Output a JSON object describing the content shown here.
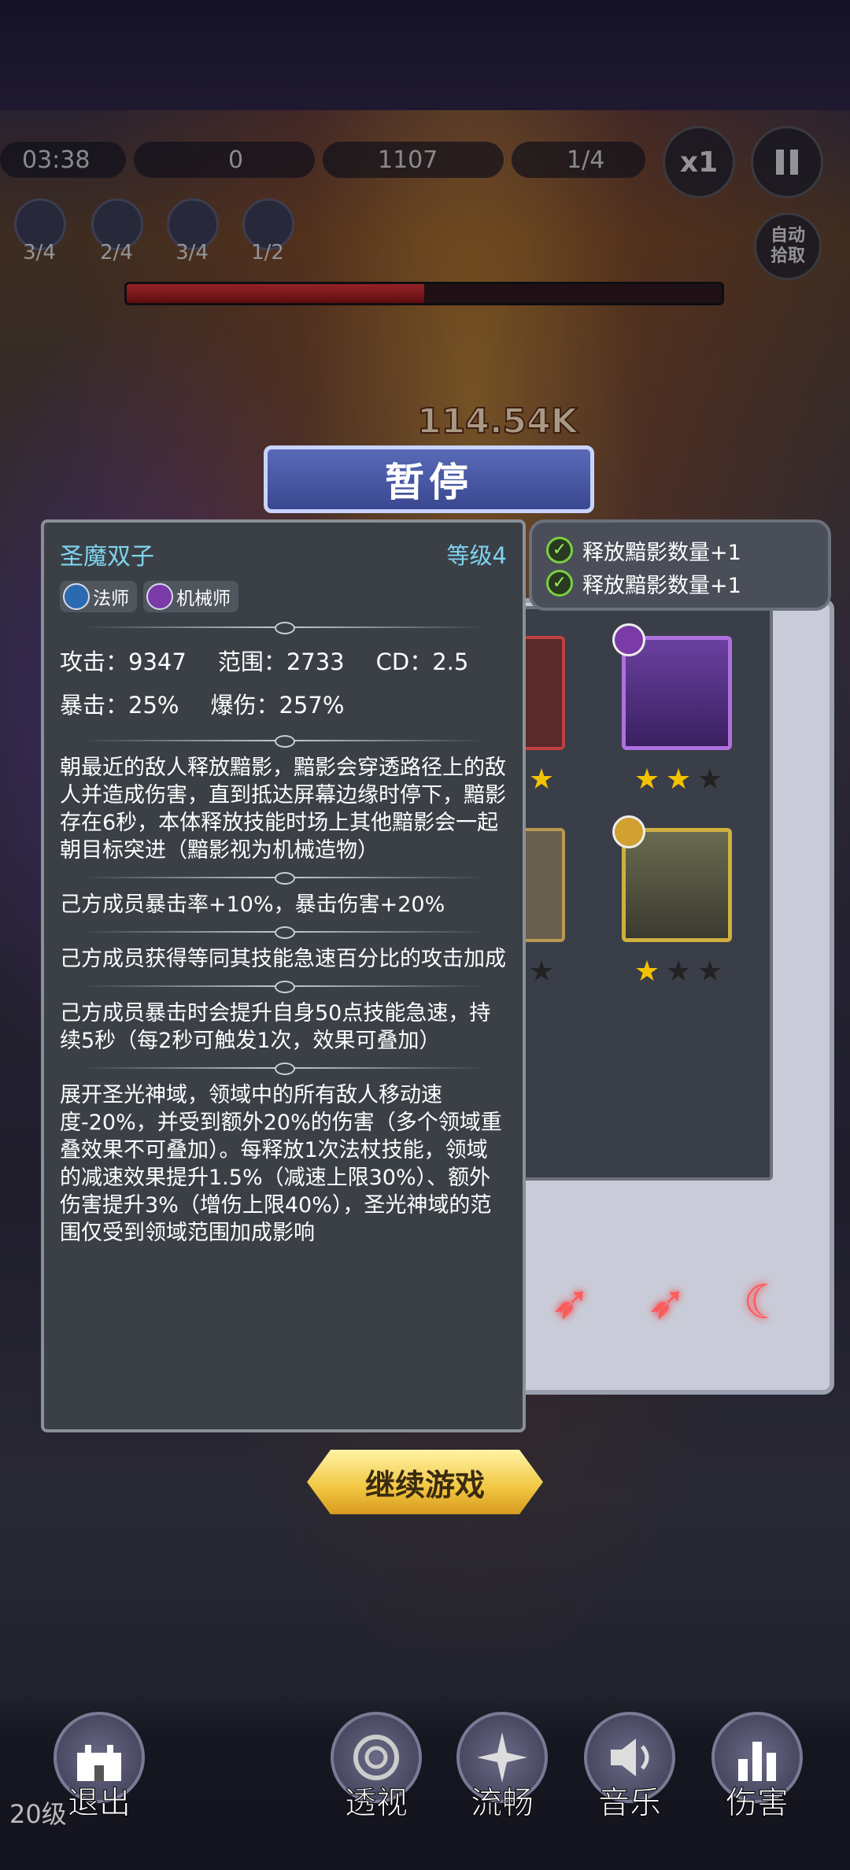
{
  "hud": {
    "time": "03:38",
    "coins": "0",
    "kills": "1107",
    "wave": "1/4",
    "speed": "x1",
    "pause_icon": "pause-icon",
    "auto_pickup": "自动拾取"
  },
  "skills": [
    {
      "count": "3/4",
      "icon": "mage-skill-icon"
    },
    {
      "count": "2/4",
      "icon": "swirl-skill-icon"
    },
    {
      "count": "3/4",
      "icon": "gear-skill-icon"
    },
    {
      "count": "1/2",
      "icon": "wrench-skill-icon"
    }
  ],
  "boss_hp": 0.5,
  "damage_float": "114.54K",
  "pause_title": "暂停",
  "effects": [
    "释放黯影数量+1",
    "释放黯影数量+1"
  ],
  "detail": {
    "name": "圣魔双子",
    "level": "等级4",
    "classes": [
      {
        "label": "法师",
        "color": "#2a6ab0"
      },
      {
        "label": "机械师",
        "color": "#7a3aa8"
      }
    ],
    "stats_row1": [
      "攻击：9347",
      "范围：2733",
      "CD：2.5"
    ],
    "stats_row2": [
      "暴击：25%",
      "爆伤：257%"
    ],
    "paragraphs": [
      "朝最近的敌人释放黯影，黯影会穿透路径上的敌人并造成伤害，直到抵达屏幕边缘时停下，黯影存在6秒，本体释放技能时场上其他黯影会一起朝目标突进（黯影视为机械造物）",
      "己方成员暴击率+10%，暴击伤害+20%",
      "己方成员获得等同其技能急速百分比的攻击加成",
      "己方成员暴击时会提升自身50点技能急速，持续5秒（每2秒可触发1次，效果可叠加）",
      "展开圣光神域，领域中的所有敌人移动速度-20%，并受到额外20%的伤害（多个领域重叠效果不可叠加）。每释放1次法杖技能，领域的减速效果提升1.5%（减速上限30%）、额外伤害提升3%（增伤上限40%），圣光神域的范围仅受到领域范围加成影响"
    ]
  },
  "team": [
    {
      "stars": 1,
      "class_icon": "gear-icon"
    },
    {
      "stars": 2,
      "class_icon": "gear-icon"
    },
    {
      "stars": 0,
      "class_icon": "staff-icon"
    },
    {
      "stars": 1,
      "class_icon": "staff-icon"
    }
  ],
  "continue_label": "继续游戏",
  "bottom_nav": [
    {
      "label": "退出",
      "icon": "castle-icon"
    },
    {
      "label": "透视",
      "icon": "swirl-icon"
    },
    {
      "label": "流畅",
      "icon": "sparkle-icon"
    },
    {
      "label": "音乐",
      "icon": "speaker-icon"
    },
    {
      "label": "伤害",
      "icon": "bar-chart-icon"
    }
  ],
  "player_level": "20级"
}
